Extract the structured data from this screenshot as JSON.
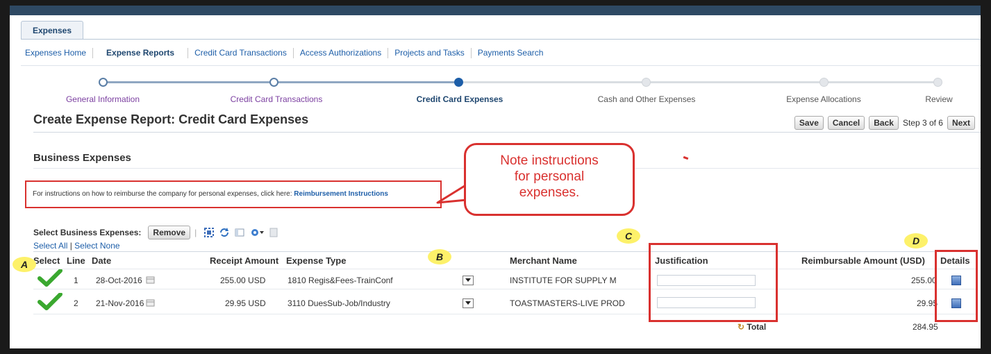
{
  "main_tab": "Expenses",
  "subnav": [
    "Expenses Home",
    "Expense Reports",
    "Credit Card Transactions",
    "Access Authorizations",
    "Projects and Tasks",
    "Payments Search"
  ],
  "train": [
    {
      "label": "General Information",
      "state": "visited"
    },
    {
      "label": "Credit Card Transactions",
      "state": "visited"
    },
    {
      "label": "Credit Card Expenses",
      "state": "current"
    },
    {
      "label": "Cash and Other Expenses",
      "state": "future"
    },
    {
      "label": "Expense Allocations",
      "state": "future"
    },
    {
      "label": "Review",
      "state": "future"
    }
  ],
  "page_title": "Create Expense Report: Credit Card Expenses",
  "buttons": {
    "save": "Save",
    "cancel": "Cancel",
    "back": "Back",
    "step": "Step 3 of 6",
    "next": "Next"
  },
  "section_title": "Business Expenses",
  "instructions": {
    "text": "For instructions on how to reimburse the company for personal expenses, click here: ",
    "link": "Reimbursement Instructions"
  },
  "callout": {
    "line1": "Note instructions",
    "line2": "for personal",
    "line3": "expenses."
  },
  "toolbar": {
    "label": "Select Business Expenses:",
    "remove": "Remove"
  },
  "select_all": "Select All",
  "select_none": "Select None",
  "columns": {
    "select": "Select",
    "line": "Line",
    "date": "Date",
    "receipt": "Receipt Amount",
    "type": "Expense Type",
    "merchant": "Merchant Name",
    "justification": "Justification",
    "reimb": "Reimbursable Amount (USD)",
    "details": "Details"
  },
  "rows": [
    {
      "line": "1",
      "date": "28-Oct-2016",
      "receipt": "255.00 USD",
      "type": "1810 Regis&Fees-TrainConf",
      "merchant": "INSTITUTE FOR SUPPLY M",
      "reimb": "255.00"
    },
    {
      "line": "2",
      "date": "21-Nov-2016",
      "receipt": "29.95 USD",
      "type": "3110 DuesSub-Job/Industry",
      "merchant": "TOASTMASTERS-LIVE PROD",
      "reimb": "29.95"
    }
  ],
  "total_label": "Total",
  "total_value": "284.95",
  "annotations": {
    "a": "A",
    "b": "B",
    "c": "C",
    "d": "D"
  },
  "colors": {
    "header_bar": "#2e4963",
    "link": "#1d5ea8",
    "annotation_red": "#d9312f",
    "bubble_yellow": "#fdf16a",
    "check_green": "#3aa82f"
  }
}
